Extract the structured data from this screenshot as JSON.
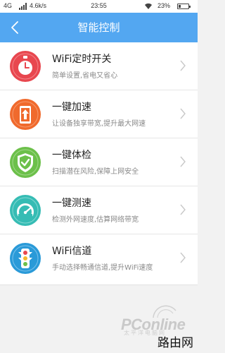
{
  "status_bar": {
    "network": "4G",
    "speed": "4.6k/s",
    "time": "23:55",
    "battery": "23%",
    "battery_level": 0.23
  },
  "nav": {
    "title": "智能控制"
  },
  "menu": {
    "items": [
      {
        "title": "WiFi定时开关",
        "desc": "简单设置,省电又省心",
        "icon": "stopwatch-icon",
        "color": "#e8474f"
      },
      {
        "title": "一键加速",
        "desc": "让设备独享带宽,提升最大网速",
        "icon": "boost-arrow-icon",
        "color": "#f06a2d"
      },
      {
        "title": "一键体检",
        "desc": "扫描潜在风险,保障上网安全",
        "icon": "shield-check-icon",
        "color": "#6cc04a"
      },
      {
        "title": "一键测速",
        "desc": "检测外网速度,估算网络带宽",
        "icon": "speedometer-icon",
        "color": "#36bcb4"
      },
      {
        "title": "WiFi信道",
        "desc": "手动选择畅通信道,提升WiFi速度",
        "icon": "traffic-light-icon",
        "color": "#2a9ad8"
      }
    ]
  },
  "watermark": {
    "brand": "PConline",
    "sub": "太平洋电脑网"
  },
  "corner_brand": "路由网",
  "colors": {
    "nav_bg": "#53a7f1",
    "page_bg": "#f2f2f2"
  }
}
